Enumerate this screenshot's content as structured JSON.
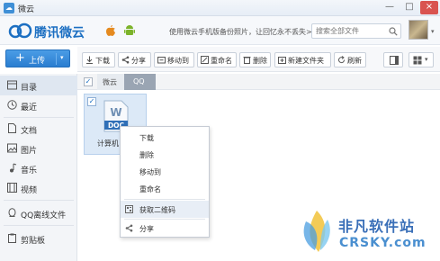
{
  "window": {
    "title": "微云",
    "minimize": "—",
    "maximize": "□",
    "close": "×"
  },
  "header": {
    "logo_text": "腾讯微云",
    "promo": "使用微云手机版备份照片，让回忆永不丢失>>",
    "search_placeholder": "搜索全部文件",
    "avatar_arrow": "▾"
  },
  "upload": {
    "label": "上传",
    "plus": "+",
    "caret": "▾"
  },
  "sidebar": {
    "items": [
      {
        "label": "目录",
        "icon": "folder-icon"
      },
      {
        "label": "最近",
        "icon": "clock-icon"
      },
      {
        "label": "文档",
        "icon": "document-icon"
      },
      {
        "label": "图片",
        "icon": "image-icon"
      },
      {
        "label": "音乐",
        "icon": "music-icon"
      },
      {
        "label": "视频",
        "icon": "video-icon"
      },
      {
        "label": "QQ离线文件",
        "icon": "qq-icon"
      },
      {
        "label": "剪贴板",
        "icon": "clipboard-icon"
      }
    ]
  },
  "toolbar": {
    "buttons": [
      {
        "label": "下载",
        "icon": "download-icon"
      },
      {
        "label": "分享",
        "icon": "share-icon"
      },
      {
        "label": "移动到",
        "icon": "move-icon"
      },
      {
        "label": "重命名",
        "icon": "rename-icon"
      },
      {
        "label": "删除",
        "icon": "delete-icon"
      },
      {
        "label": "新建文件夹",
        "icon": "new-folder-icon"
      },
      {
        "label": "刷新",
        "icon": "refresh-icon"
      }
    ]
  },
  "breadcrumb": {
    "root": "微云",
    "current": "QQ",
    "check": "✓"
  },
  "file": {
    "name": "计算机",
    "type": "DOC",
    "check": "✓"
  },
  "context_menu": {
    "items": [
      {
        "label": "下载"
      },
      {
        "label": "删除"
      },
      {
        "label": "移动到"
      },
      {
        "label": "重命名"
      },
      {
        "label": "获取二维码",
        "icon": "qrcode-icon"
      },
      {
        "label": "分享",
        "icon": "share-icon"
      }
    ]
  },
  "watermark": {
    "title": "非凡软件站",
    "subtitle": "CRSKY.com"
  },
  "colors": {
    "accent": "#2a7dd0",
    "logo": "#1c6fc2"
  }
}
